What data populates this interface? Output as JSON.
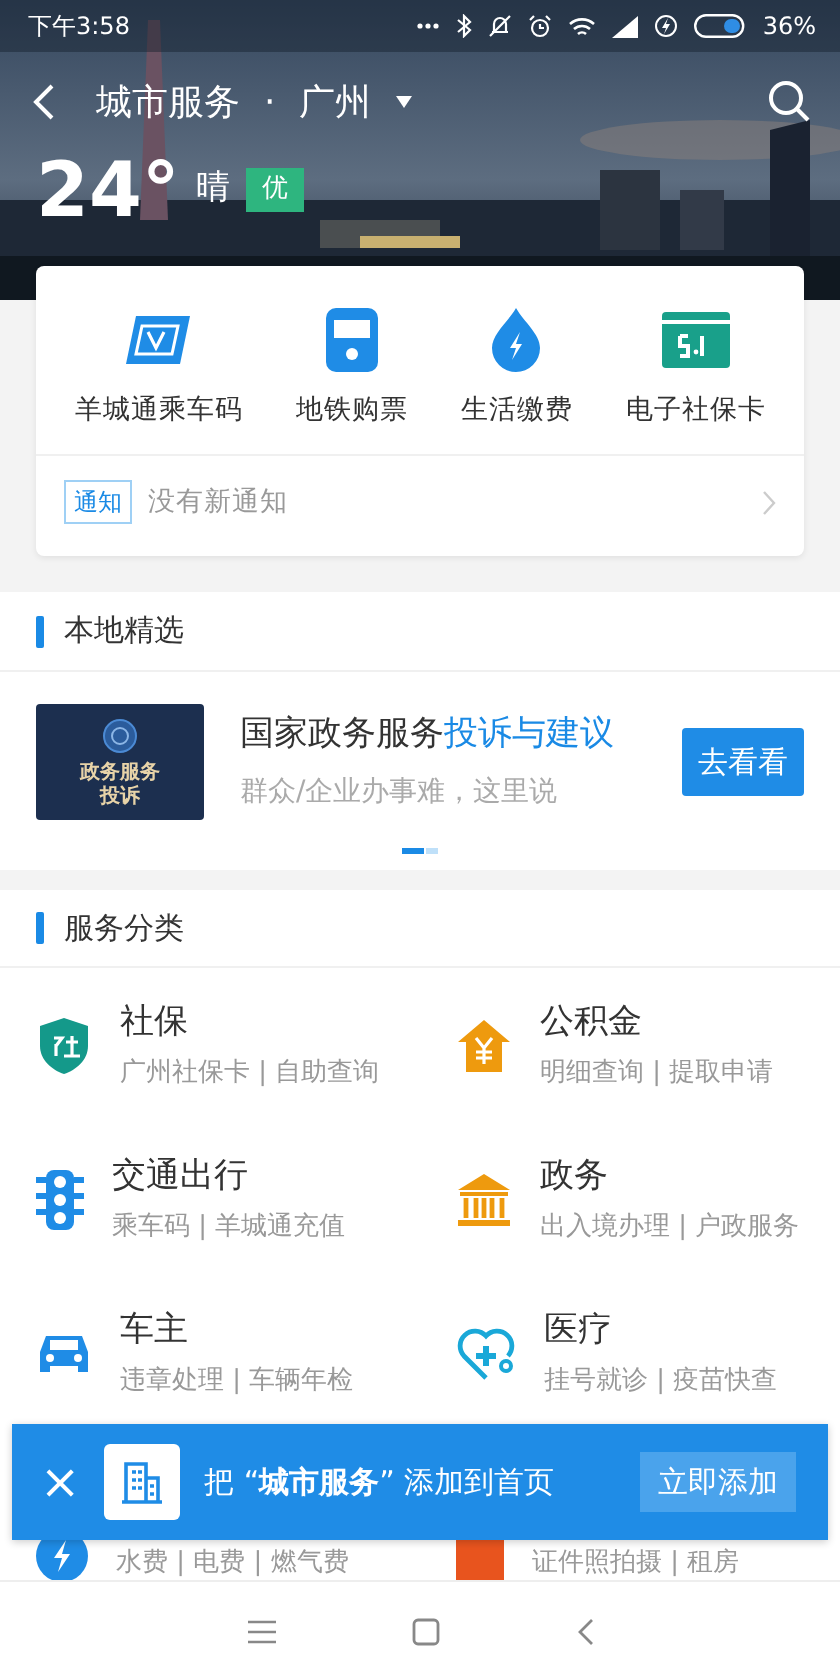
{
  "status_bar": {
    "time": "下午3:58",
    "battery": "36%"
  },
  "header": {
    "title": "城市服务",
    "separator": "·",
    "city": "广州",
    "temperature": "24°",
    "weather": "晴",
    "air_quality": "优"
  },
  "quick_services": [
    {
      "label": "羊城通乘车码"
    },
    {
      "label": "地铁购票"
    },
    {
      "label": "生活缴费"
    },
    {
      "label": "电子社保卡"
    }
  ],
  "notice": {
    "tag": "通知",
    "text": "没有新通知"
  },
  "local_picks": {
    "title": "本地精选",
    "thumbnail_lines": [
      "政务服务",
      "投诉"
    ],
    "headline": "国家政务服务",
    "headline_highlight": "投诉与建议",
    "subtitle": "群众/企业办事难，这里说",
    "button": "去看看",
    "carousel_dots": [
      {
        "selected": true
      },
      {
        "selected": false
      }
    ]
  },
  "categories": {
    "title": "服务分类",
    "items": [
      {
        "title": "社保",
        "subtitle": "广州社保卡 | 自助查询"
      },
      {
        "title": "公积金",
        "subtitle": "明细查询 | 提取申请"
      },
      {
        "title": "交通出行",
        "subtitle": "乘车码 | 羊城通充值"
      },
      {
        "title": "政务",
        "subtitle": "出入境办理 | 户政服务"
      },
      {
        "title": "车主",
        "subtitle": "违章处理 | 车辆年检"
      },
      {
        "title": "医疗",
        "subtitle": "挂号就诊 | 疫苗快查"
      },
      {
        "subtitle": "水费 | 电费 | 燃气费"
      },
      {
        "subtitle": "证件照拍摄 | 租房"
      }
    ]
  },
  "add_banner": {
    "close": "×",
    "text": "把 “**城市服务**” 添加到首页",
    "button": "立即添加"
  }
}
